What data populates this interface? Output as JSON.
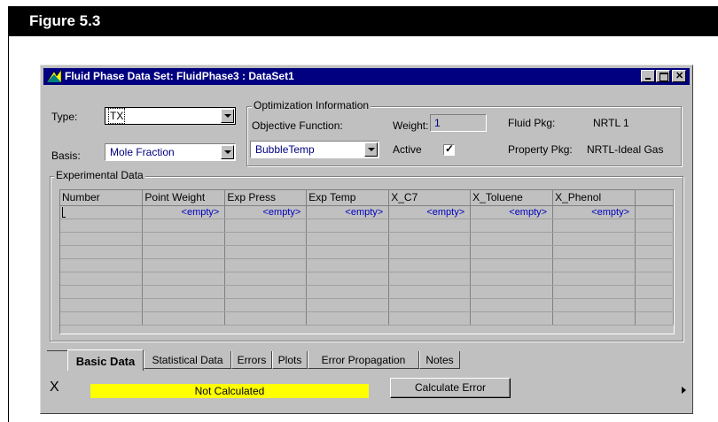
{
  "figure": {
    "title": "Figure 5.3"
  },
  "window": {
    "title": "Fluid Phase Data Set: FluidPhase3 : DataSet1"
  },
  "type": {
    "label": "Type:",
    "value": "TX"
  },
  "basis": {
    "label": "Basis:",
    "value": "Mole Fraction"
  },
  "optimization": {
    "group_title": "Optimization Information",
    "objective_label": "Objective Function:",
    "objective_value": "BubbleTemp",
    "weight_label": "Weight:",
    "weight_value": "1",
    "active_label": "Active",
    "active_checked": true,
    "fluid_pkg_label": "Fluid Pkg:",
    "fluid_pkg_value": "NRTL 1",
    "property_pkg_label": "Property Pkg:",
    "property_pkg_value": "NRTL-Ideal Gas"
  },
  "experimental": {
    "group_title": "Experimental Data",
    "columns": [
      "Number",
      "Point Weight",
      "Exp Press",
      "Exp Temp",
      "X_C7",
      "X_Toluene",
      "X_Phenol"
    ],
    "first_row": [
      "",
      "<empty>",
      "<empty>",
      "<empty>",
      "<empty>",
      "<empty>",
      "<empty>"
    ]
  },
  "tabs": [
    "Basic Data",
    "Statistical Data",
    "Errors",
    "Plots",
    "Error Propagation",
    "Notes"
  ],
  "status": {
    "icon": "X",
    "text": "Not Calculated",
    "color": "#ffff00"
  },
  "calculate_button": "Calculate Error",
  "icons": {
    "window": "data-set-icon",
    "corner": "right-arrow-icon"
  }
}
